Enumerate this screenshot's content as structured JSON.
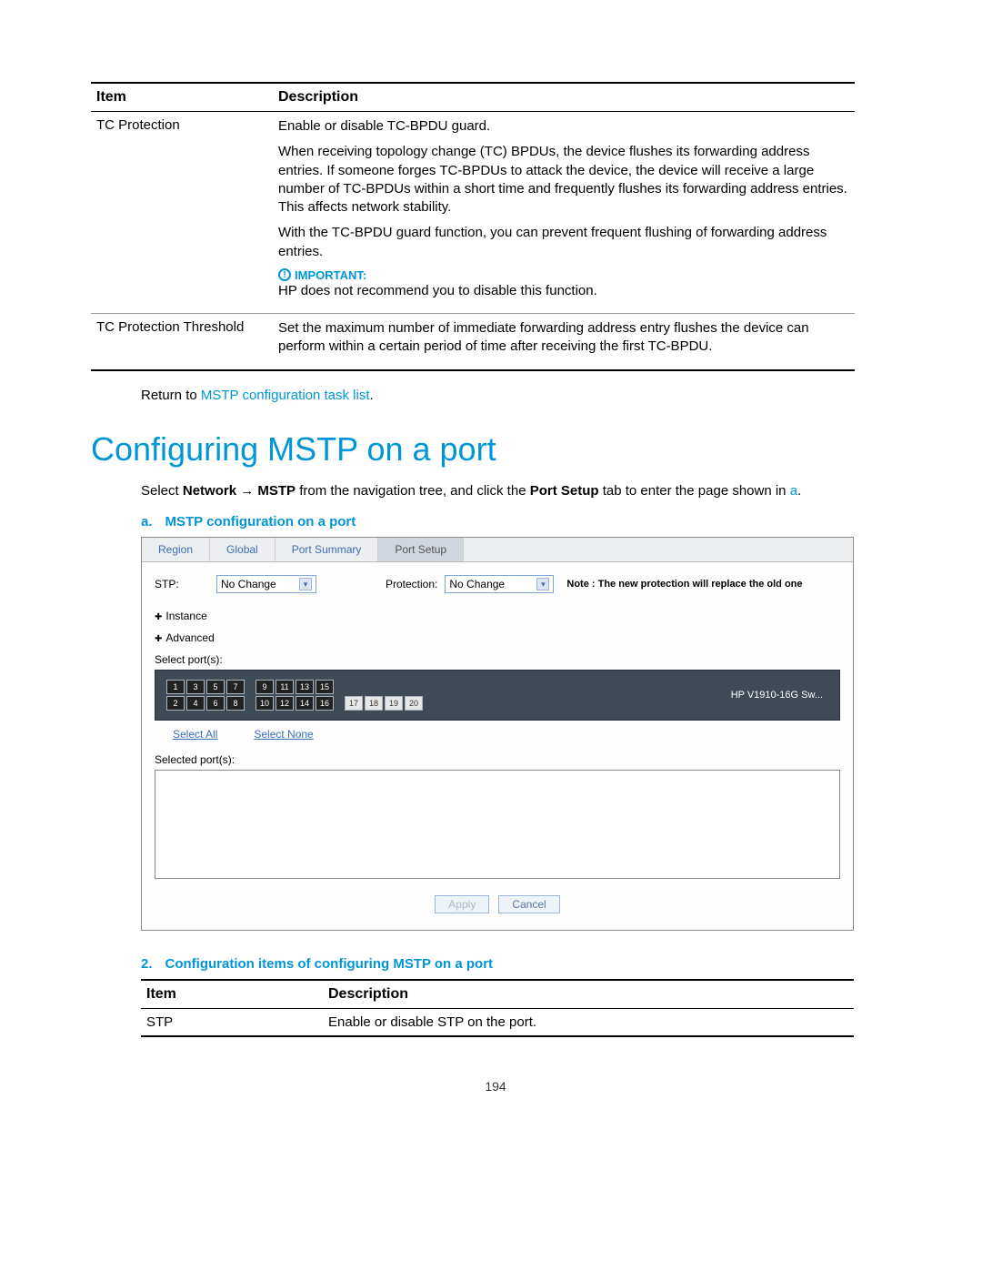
{
  "table1": {
    "headers": {
      "item": "Item",
      "desc": "Description"
    },
    "rows": [
      {
        "item": "TC Protection",
        "p1": "Enable or disable TC-BPDU guard.",
        "p2": "When receiving topology change (TC) BPDUs, the device flushes its forwarding address entries. If someone forges TC-BPDUs to attack the device, the device will receive a large number of TC-BPDUs within a short time and frequently flushes its forwarding address entries. This affects network stability.",
        "p3": "With the TC-BPDU guard function, you can prevent frequent flushing of forwarding address entries.",
        "important_label": "IMPORTANT:",
        "important_text": "HP does not recommend you to disable this function."
      },
      {
        "item": "TC Protection Threshold",
        "p1": "Set the maximum number of immediate forwarding address entry flushes the device can perform within a certain period of time after receiving the first TC-BPDU."
      }
    ]
  },
  "return_line": {
    "prefix": "Return to ",
    "link": "MSTP configuration task list",
    "suffix": "."
  },
  "heading": "Configuring MSTP on a port",
  "intro": {
    "t1": "Select ",
    "b1": "Network",
    "t_arrow": " → ",
    "b2": "MSTP",
    "t2": " from the navigation tree, and click the ",
    "b3": "Port Setup",
    "t3": " tab to enter the page shown in ",
    "link": "a",
    "t4": "."
  },
  "caption_a": {
    "num": "a.",
    "text": "MSTP configuration on a port"
  },
  "screenshot": {
    "tabs": [
      "Region",
      "Global",
      "Port Summary",
      "Port Setup"
    ],
    "active_tab_index": 3,
    "stp_label": "STP:",
    "stp_value": "No Change",
    "protection_label": "Protection:",
    "protection_value": "No Change",
    "note": "Note : The new protection will replace the old one",
    "instance": "Instance",
    "advanced": "Advanced",
    "select_ports_label": "Select port(s):",
    "ports_top": [
      "1",
      "3",
      "5",
      "7",
      "9",
      "11",
      "13",
      "15"
    ],
    "ports_bottom": [
      "2",
      "4",
      "6",
      "8",
      "10",
      "12",
      "14",
      "16"
    ],
    "ports_extra": [
      "17",
      "18",
      "19",
      "20"
    ],
    "device": "HP V1910-16G Sw...",
    "select_all": "Select All",
    "select_none": "Select None",
    "selected_label": "Selected port(s):",
    "apply": "Apply",
    "cancel": "Cancel"
  },
  "caption_2": {
    "num": "2.",
    "text": "Configuration items of configuring MSTP on a port"
  },
  "table2": {
    "headers": {
      "item": "Item",
      "desc": "Description"
    },
    "row": {
      "item": "STP",
      "desc": "Enable or disable STP on the port."
    }
  },
  "page_number": "194"
}
